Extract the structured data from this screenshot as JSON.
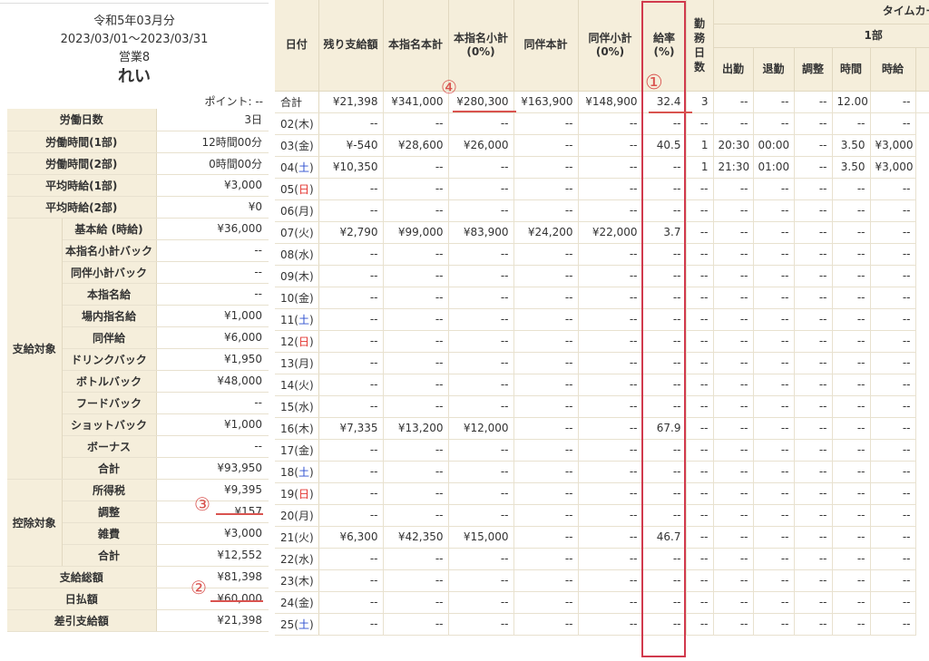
{
  "header": {
    "period_month": "令和5年03月分",
    "period_range": "2023/03/01〜2023/03/31",
    "store": "営業8",
    "name": "れい",
    "points": "ポイント: --"
  },
  "summary": {
    "rows": [
      {
        "label": "労働日数",
        "value": "3日"
      },
      {
        "label": "労働時間(1部)",
        "value": "12時間00分"
      },
      {
        "label": "労働時間(2部)",
        "value": "0時間00分"
      },
      {
        "label": "平均時給(1部)",
        "value": "¥3,000"
      },
      {
        "label": "平均時給(2部)",
        "value": "¥0"
      }
    ],
    "pay_group": "支給対象",
    "pay_items": [
      {
        "label": "基本給 (時給)",
        "value": "¥36,000"
      },
      {
        "label": "本指名小計バック",
        "value": "--"
      },
      {
        "label": "同伴小計バック",
        "value": "--"
      },
      {
        "label": "本指名給",
        "value": "--"
      },
      {
        "label": "場内指名給",
        "value": "¥1,000"
      },
      {
        "label": "同伴給",
        "value": "¥6,000"
      },
      {
        "label": "ドリンクバック",
        "value": "¥1,950"
      },
      {
        "label": "ボトルバック",
        "value": "¥48,000"
      },
      {
        "label": "フードバック",
        "value": "--"
      },
      {
        "label": "ショットバック",
        "value": "¥1,000"
      },
      {
        "label": "ボーナス",
        "value": "--"
      },
      {
        "label": "合計",
        "value": "¥93,950"
      }
    ],
    "deduct_group": "控除対象",
    "deduct_items": [
      {
        "label": "所得税",
        "value": "¥9,395"
      },
      {
        "label": "調整",
        "value": "¥157"
      },
      {
        "label": "雑費",
        "value": "¥3,000"
      },
      {
        "label": "合計",
        "value": "¥12,552"
      }
    ],
    "footer_rows": [
      {
        "label": "支給総額",
        "value": "¥81,398"
      },
      {
        "label": "日払額",
        "value": "¥60,000"
      },
      {
        "label": "差引支給額",
        "value": "¥21,398"
      }
    ]
  },
  "annotations": {
    "c1": "①",
    "c2": "②",
    "c3": "③",
    "c4": "④",
    "color": "#d9534f"
  },
  "table": {
    "headers": {
      "date": "日付",
      "remaining": "残り支給額",
      "honshimei_total": "本指名本計",
      "honshimei_sub": "本指名小計\n(0%)",
      "douhan_total": "同伴本計",
      "douhan_sub": "同伴小計\n(0%)",
      "rate": "給率\n(%)",
      "workdays": "勤\n務\n日\n数",
      "timecard": "タイムカード",
      "part1": "1部",
      "clock_in": "出勤",
      "clock_out": "退勤",
      "adjust": "調整",
      "hours": "時間",
      "hourly": "時給"
    },
    "total": [
      "合計",
      "¥21,398",
      "¥341,000",
      "¥280,300",
      "¥163,900",
      "¥148,900",
      "32.4",
      "3",
      "--",
      "--",
      "--",
      "12.00",
      "--"
    ],
    "rows": [
      {
        "date": "02(木)",
        "day": "",
        "cells": [
          "--",
          "--",
          "--",
          "--",
          "--",
          "--",
          "--",
          "--",
          "--",
          "--",
          "--",
          "--"
        ]
      },
      {
        "date": "03(金)",
        "day": "",
        "cells": [
          "¥-540",
          "¥28,600",
          "¥26,000",
          "--",
          "--",
          "40.5",
          "1",
          "20:30",
          "00:00",
          "--",
          "3.50",
          "¥3,000"
        ]
      },
      {
        "date": "04(土)",
        "day": "sat",
        "cells": [
          "¥10,350",
          "--",
          "--",
          "--",
          "--",
          "--",
          "1",
          "21:30",
          "01:00",
          "--",
          "3.50",
          "¥3,000"
        ]
      },
      {
        "date": "05(日)",
        "day": "sun",
        "cells": [
          "--",
          "--",
          "--",
          "--",
          "--",
          "--",
          "--",
          "--",
          "--",
          "--",
          "--",
          "--"
        ]
      },
      {
        "date": "06(月)",
        "day": "",
        "cells": [
          "--",
          "--",
          "--",
          "--",
          "--",
          "--",
          "--",
          "--",
          "--",
          "--",
          "--",
          "--"
        ]
      },
      {
        "date": "07(火)",
        "day": "",
        "cells": [
          "¥2,790",
          "¥99,000",
          "¥83,900",
          "¥24,200",
          "¥22,000",
          "3.7",
          "--",
          "--",
          "--",
          "--",
          "--",
          "--"
        ]
      },
      {
        "date": "08(水)",
        "day": "",
        "cells": [
          "--",
          "--",
          "--",
          "--",
          "--",
          "--",
          "--",
          "--",
          "--",
          "--",
          "--",
          "--"
        ]
      },
      {
        "date": "09(木)",
        "day": "",
        "cells": [
          "--",
          "--",
          "--",
          "--",
          "--",
          "--",
          "--",
          "--",
          "--",
          "--",
          "--",
          "--"
        ]
      },
      {
        "date": "10(金)",
        "day": "",
        "cells": [
          "--",
          "--",
          "--",
          "--",
          "--",
          "--",
          "--",
          "--",
          "--",
          "--",
          "--",
          "--"
        ]
      },
      {
        "date": "11(土)",
        "day": "sat",
        "cells": [
          "--",
          "--",
          "--",
          "--",
          "--",
          "--",
          "--",
          "--",
          "--",
          "--",
          "--",
          "--"
        ]
      },
      {
        "date": "12(日)",
        "day": "sun",
        "cells": [
          "--",
          "--",
          "--",
          "--",
          "--",
          "--",
          "--",
          "--",
          "--",
          "--",
          "--",
          "--"
        ]
      },
      {
        "date": "13(月)",
        "day": "",
        "cells": [
          "--",
          "--",
          "--",
          "--",
          "--",
          "--",
          "--",
          "--",
          "--",
          "--",
          "--",
          "--"
        ]
      },
      {
        "date": "14(火)",
        "day": "",
        "cells": [
          "--",
          "--",
          "--",
          "--",
          "--",
          "--",
          "--",
          "--",
          "--",
          "--",
          "--",
          "--"
        ]
      },
      {
        "date": "15(水)",
        "day": "",
        "cells": [
          "--",
          "--",
          "--",
          "--",
          "--",
          "--",
          "--",
          "--",
          "--",
          "--",
          "--",
          "--"
        ]
      },
      {
        "date": "16(木)",
        "day": "",
        "cells": [
          "¥7,335",
          "¥13,200",
          "¥12,000",
          "--",
          "--",
          "67.9",
          "--",
          "--",
          "--",
          "--",
          "--",
          "--"
        ]
      },
      {
        "date": "17(金)",
        "day": "",
        "cells": [
          "--",
          "--",
          "--",
          "--",
          "--",
          "--",
          "--",
          "--",
          "--",
          "--",
          "--",
          "--"
        ]
      },
      {
        "date": "18(土)",
        "day": "sat",
        "cells": [
          "--",
          "--",
          "--",
          "--",
          "--",
          "--",
          "--",
          "--",
          "--",
          "--",
          "--",
          "--"
        ]
      },
      {
        "date": "19(日)",
        "day": "sun",
        "cells": [
          "--",
          "--",
          "--",
          "--",
          "--",
          "--",
          "--",
          "--",
          "--",
          "--",
          "--",
          "--"
        ]
      },
      {
        "date": "20(月)",
        "day": "",
        "cells": [
          "--",
          "--",
          "--",
          "--",
          "--",
          "--",
          "--",
          "--",
          "--",
          "--",
          "--",
          "--"
        ]
      },
      {
        "date": "21(火)",
        "day": "",
        "cells": [
          "¥6,300",
          "¥42,350",
          "¥15,000",
          "--",
          "--",
          "46.7",
          "--",
          "--",
          "--",
          "--",
          "--",
          "--"
        ]
      },
      {
        "date": "22(水)",
        "day": "",
        "cells": [
          "--",
          "--",
          "--",
          "--",
          "--",
          "--",
          "--",
          "--",
          "--",
          "--",
          "--",
          "--"
        ]
      },
      {
        "date": "23(木)",
        "day": "",
        "cells": [
          "--",
          "--",
          "--",
          "--",
          "--",
          "--",
          "--",
          "--",
          "--",
          "--",
          "--",
          "--"
        ]
      },
      {
        "date": "24(金)",
        "day": "",
        "cells": [
          "--",
          "--",
          "--",
          "--",
          "--",
          "--",
          "--",
          "--",
          "--",
          "--",
          "--",
          "--"
        ]
      },
      {
        "date": "25(土)",
        "day": "sat",
        "cells": [
          "--",
          "--",
          "--",
          "--",
          "--",
          "--",
          "--",
          "--",
          "--",
          "--",
          "--",
          "--"
        ]
      }
    ]
  }
}
